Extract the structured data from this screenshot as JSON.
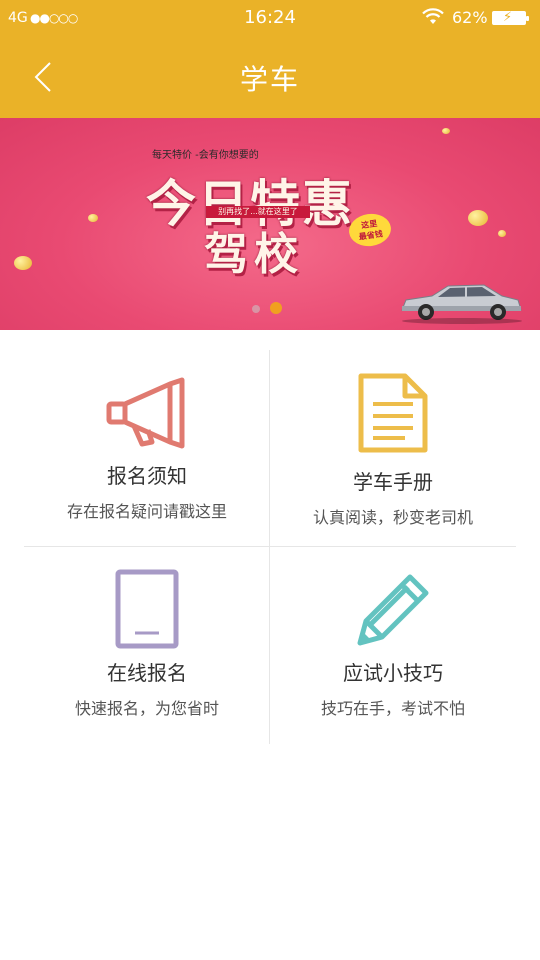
{
  "status_bar": {
    "network": "4G",
    "signal": "●●○○○",
    "time": "16:24",
    "battery_percent": "62%"
  },
  "header": {
    "title": "学车",
    "back_icon": "chevron-left-icon",
    "background": "#eab228"
  },
  "banner": {
    "tagline": "每天特价 -会有你想要的",
    "headline_line1": "今日特惠",
    "ribbon": "别再找了...就在这里了",
    "headline_line2": "驾校",
    "stamp_line1": "这里",
    "stamp_line2": "最省钱",
    "page_indicator": {
      "count": 2,
      "active": 2
    }
  },
  "features": [
    {
      "name": "报名须知",
      "desc": "存在报名疑问请戳这里",
      "icon": "megaphone-icon",
      "color": "#e07a70"
    },
    {
      "name": "学车手册",
      "desc": "认真阅读，秒变老司机",
      "icon": "document-icon",
      "color": "#edbd4a"
    },
    {
      "name": "在线报名",
      "desc": "快速报名，为您省时",
      "icon": "tablet-icon",
      "color": "#a79ac6"
    },
    {
      "name": "应试小技巧",
      "desc": "技巧在手，考试不怕",
      "icon": "pencil-icon",
      "color": "#63c3c0"
    }
  ]
}
